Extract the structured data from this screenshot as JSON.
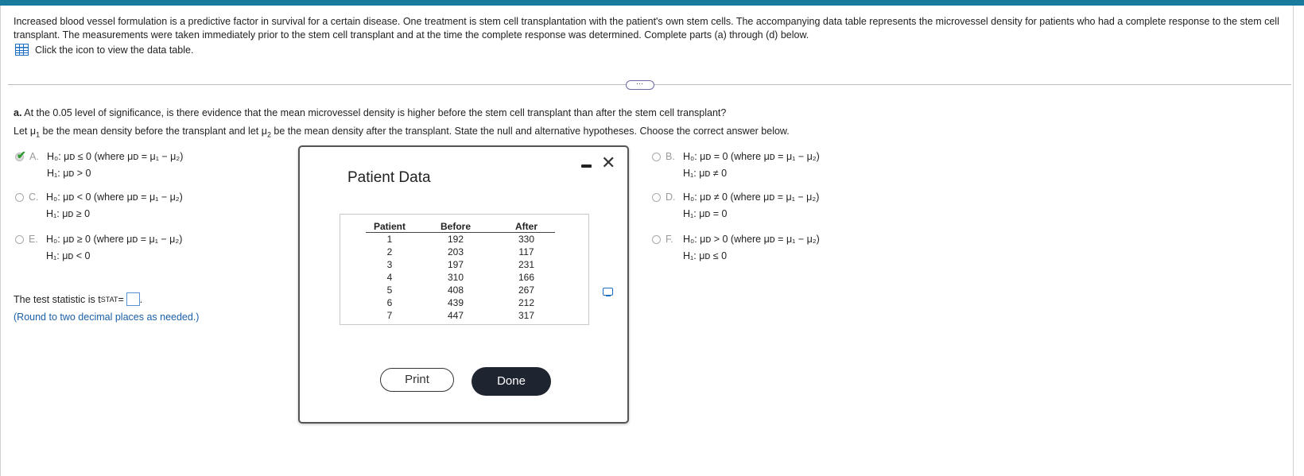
{
  "intro_text": "Increased blood vessel formulation is a predictive factor in survival for a certain disease. One treatment is stem cell transplantation with the patient's own stem cells. The accompanying data table represents the microvessel density for patients who had a complete response to the stem cell transplant. The measurements were taken immediately prior to the stem cell transplant and at the time the complete response was determined. Complete parts (a) through (d) below.",
  "table_link": "Click the icon to view the data table.",
  "expand_label": "⋯",
  "question_a_prefix": "a.",
  "question_a": "At the 0.05 level of significance, is there evidence that the mean microvessel density is higher before the stem cell transplant than after the stem cell transplant?",
  "let_text": {
    "p1": "Let μ",
    "s1": "1",
    "p2": " be the mean density before the transplant and let μ",
    "s2": "2",
    "p3": " be the mean density after the transplant. State the null and alternative hypotheses. Choose the correct answer below."
  },
  "options": [
    {
      "letter": "A.",
      "h0": "H₀: μᴅ ≤ 0 (where μᴅ = μ₁ − μ₂)",
      "h1": "H₁: μᴅ > 0",
      "selected": true
    },
    {
      "letter": "B.",
      "h0": "H₀: μᴅ = 0 (where μᴅ = μ₁ − μ₂)",
      "h1": "H₁: μᴅ ≠ 0",
      "selected": false
    },
    {
      "letter": "C.",
      "h0": "H₀: μᴅ < 0 (where μᴅ = μ₁ − μ₂)",
      "h1": "H₁: μᴅ ≥ 0",
      "selected": false
    },
    {
      "letter": "D.",
      "h0": "H₀: μᴅ ≠ 0 (where μᴅ = μ₁ − μ₂)",
      "h1": "H₁: μᴅ = 0",
      "selected": false
    },
    {
      "letter": "E.",
      "h0": "H₀: μᴅ ≥ 0 (where μᴅ = μ₁ − μ₂)",
      "h1": "H₁: μᴅ < 0",
      "selected": false
    },
    {
      "letter": "F.",
      "h0": "H₀: μᴅ > 0 (where μᴅ = μ₁ − μ₂)",
      "h1": "H₁: μᴅ ≤ 0",
      "selected": false
    }
  ],
  "test_stat": {
    "prefix": "The test statistic is t",
    "sub": "STAT",
    "suffix": " =",
    "value": "",
    "end": "."
  },
  "round_note": "(Round to two decimal places as needed.)",
  "modal": {
    "title": "Patient Data",
    "columns": [
      "Patient",
      "Before",
      "After"
    ],
    "rows": [
      [
        "1",
        "192",
        "330"
      ],
      [
        "2",
        "203",
        "117"
      ],
      [
        "3",
        "197",
        "231"
      ],
      [
        "4",
        "310",
        "166"
      ],
      [
        "5",
        "408",
        "267"
      ],
      [
        "6",
        "439",
        "212"
      ],
      [
        "7",
        "447",
        "317"
      ]
    ],
    "print_label": "Print",
    "done_label": "Done",
    "close_label": "✕"
  },
  "colors": {
    "accent": "#1a7a9c",
    "done_bg": "#1e2430",
    "link": "#1a5fa8",
    "check": "#2e9a2e"
  }
}
